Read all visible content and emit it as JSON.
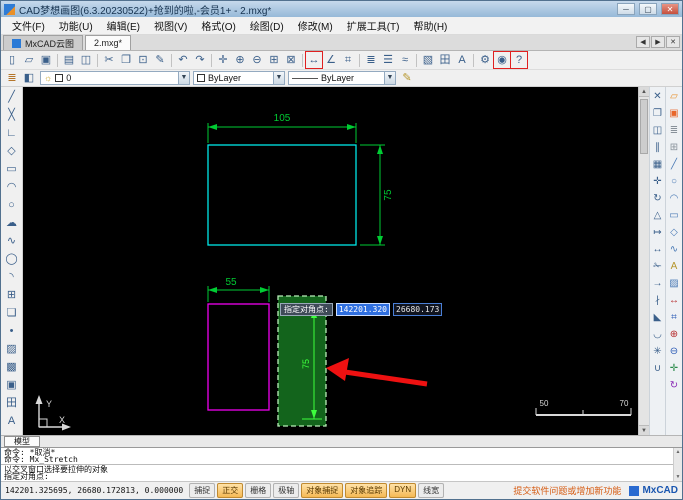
{
  "titlebar": {
    "title": "CAD梦想画图(6.3.20230522)+抢到的啦,-会员1+ - 2.mxg*"
  },
  "menubar": {
    "items": [
      {
        "name": "menu-file",
        "label": "文件(F)"
      },
      {
        "name": "menu-function",
        "label": "功能(U)"
      },
      {
        "name": "menu-edit",
        "label": "编辑(E)"
      },
      {
        "name": "menu-view",
        "label": "视图(V)"
      },
      {
        "name": "menu-format",
        "label": "格式(O)"
      },
      {
        "name": "menu-draw",
        "label": "绘图(D)"
      },
      {
        "name": "menu-modify",
        "label": "修改(M)"
      },
      {
        "name": "menu-ext-tools",
        "label": "扩展工具(T)"
      },
      {
        "name": "menu-help",
        "label": "帮助(H)"
      }
    ]
  },
  "tabbar": {
    "tabs": [
      {
        "label": "MxCAD云图"
      },
      {
        "label": "2.mxg*"
      }
    ]
  },
  "toolbar1": {
    "items": [
      {
        "name": "new-file",
        "glyph": "▯"
      },
      {
        "name": "open-file",
        "glyph": "▱"
      },
      {
        "name": "save-file",
        "glyph": "▣"
      },
      {
        "sep": true
      },
      {
        "name": "plot",
        "glyph": "▤"
      },
      {
        "name": "print-preview",
        "glyph": "◫"
      },
      {
        "sep": true
      },
      {
        "name": "cut",
        "glyph": "✂"
      },
      {
        "name": "copy",
        "glyph": "❐"
      },
      {
        "name": "paste",
        "glyph": "⊡"
      },
      {
        "name": "format-painter",
        "glyph": "✎"
      },
      {
        "sep": true
      },
      {
        "name": "undo",
        "glyph": "↶"
      },
      {
        "name": "redo",
        "glyph": "↷"
      },
      {
        "sep": true
      },
      {
        "name": "pan",
        "glyph": "✛"
      },
      {
        "name": "zoom-in",
        "glyph": "⊕"
      },
      {
        "name": "zoom-out",
        "glyph": "⊖"
      },
      {
        "name": "zoom-window",
        "glyph": "⊞"
      },
      {
        "name": "zoom-extents",
        "glyph": "⊠"
      },
      {
        "sep": true
      },
      {
        "name": "measure-distance",
        "glyph": "↔",
        "hl": true
      },
      {
        "name": "measure-angle",
        "glyph": "∠"
      },
      {
        "name": "measure-area",
        "glyph": "⌗"
      },
      {
        "sep": true
      },
      {
        "name": "layer-manager",
        "glyph": "≣"
      },
      {
        "name": "properties-palette",
        "glyph": "☰"
      },
      {
        "name": "linetype-manager",
        "glyph": "≈"
      },
      {
        "sep": true
      },
      {
        "name": "insert-image",
        "glyph": "▧"
      },
      {
        "name": "insert-table",
        "glyph": "田"
      },
      {
        "name": "find-text",
        "glyph": "A"
      },
      {
        "sep": true
      },
      {
        "name": "options",
        "glyph": "⚙"
      },
      {
        "name": "record-tool",
        "glyph": "◉",
        "hl": true
      },
      {
        "name": "help-tool",
        "glyph": "?",
        "hl": true
      }
    ]
  },
  "toolbar2": {
    "left_icons": [
      {
        "name": "layer-properties",
        "glyph": "≣",
        "color": "#b5762a"
      },
      {
        "name": "layer-states",
        "glyph": "◧",
        "color": "#3a5f8a"
      }
    ],
    "right_icons": [
      {
        "name": "match-properties",
        "glyph": "✎",
        "color": "#b5952a"
      }
    ],
    "layer_value": "0",
    "color_value": "ByLayer",
    "linetype_value": "ByLayer"
  },
  "left_toolbar": {
    "items": [
      {
        "name": "draw-line",
        "glyph": "╱"
      },
      {
        "name": "draw-construction-line",
        "glyph": "╳"
      },
      {
        "name": "draw-polyline",
        "glyph": "∟"
      },
      {
        "name": "draw-polygon",
        "glyph": "◇"
      },
      {
        "name": "draw-rectangle",
        "glyph": "▭"
      },
      {
        "name": "draw-arc",
        "glyph": "◠"
      },
      {
        "name": "draw-circle",
        "glyph": "○"
      },
      {
        "name": "draw-revcloud",
        "glyph": "☁"
      },
      {
        "name": "draw-spline",
        "glyph": "∿"
      },
      {
        "name": "draw-ellipse",
        "glyph": "◯"
      },
      {
        "name": "draw-ellipse-arc",
        "glyph": "◝"
      },
      {
        "name": "insert-block",
        "glyph": "⊞"
      },
      {
        "name": "make-block",
        "glyph": "❏"
      },
      {
        "name": "draw-point",
        "glyph": "•"
      },
      {
        "name": "hatch",
        "glyph": "▨"
      },
      {
        "name": "gradient",
        "glyph": "▩"
      },
      {
        "name": "region",
        "glyph": "▣"
      },
      {
        "name": "table",
        "glyph": "田"
      },
      {
        "name": "mtext",
        "glyph": "A"
      }
    ]
  },
  "right_modify": {
    "items": [
      {
        "name": "erase",
        "glyph": "✕"
      },
      {
        "name": "copy-object",
        "glyph": "❐"
      },
      {
        "name": "mirror",
        "glyph": "◫"
      },
      {
        "name": "offset",
        "glyph": "∥"
      },
      {
        "name": "array",
        "glyph": "▦"
      },
      {
        "name": "move",
        "glyph": "✛"
      },
      {
        "name": "rotate",
        "glyph": "↻"
      },
      {
        "name": "scale",
        "glyph": "△"
      },
      {
        "name": "stretch",
        "glyph": "↦"
      },
      {
        "name": "lengthen",
        "glyph": "↔"
      },
      {
        "name": "trim",
        "glyph": "✁"
      },
      {
        "name": "extend",
        "glyph": "→"
      },
      {
        "name": "break",
        "glyph": "∤"
      },
      {
        "name": "chamfer",
        "glyph": "◣"
      },
      {
        "name": "fillet",
        "glyph": "◡"
      },
      {
        "name": "explode",
        "glyph": "✳"
      },
      {
        "name": "join",
        "glyph": "∪"
      }
    ]
  },
  "right_tools": {
    "items": [
      {
        "name": "open-drawing",
        "glyph": "▱",
        "color": "#e8902a"
      },
      {
        "name": "save-drawing",
        "glyph": "▣",
        "color": "#e8662a"
      },
      {
        "name": "layer-tool",
        "glyph": "≣",
        "color": "#88919a"
      },
      {
        "name": "insert-tool",
        "glyph": "⊞",
        "color": "#88919a"
      },
      {
        "name": "line-tool",
        "glyph": "╱",
        "color": "#4a7ab5"
      },
      {
        "name": "circle-tool",
        "glyph": "○",
        "color": "#4a7ab5"
      },
      {
        "name": "arc-tool",
        "glyph": "◠",
        "color": "#4a7ab5"
      },
      {
        "name": "rect-tool",
        "glyph": "▭",
        "color": "#4a7ab5"
      },
      {
        "name": "polygon-tool",
        "glyph": "◇",
        "color": "#4a7ab5"
      },
      {
        "name": "spline-tool",
        "glyph": "∿",
        "color": "#4a7ab5"
      },
      {
        "name": "text-tool",
        "glyph": "A",
        "color": "#b5952a"
      },
      {
        "name": "hatch-tool",
        "glyph": "▨",
        "color": "#4a7ab5"
      },
      {
        "name": "dimension-tool",
        "glyph": "↔",
        "color": "#b52a2a"
      },
      {
        "name": "measure-tool",
        "glyph": "⌗",
        "color": "#2a5ab5"
      },
      {
        "name": "zoom-in-tool",
        "glyph": "⊕",
        "color": "#b52a2a"
      },
      {
        "name": "zoom-out-tool",
        "glyph": "⊖",
        "color": "#2a5ab5"
      },
      {
        "name": "pan-tool",
        "glyph": "✛",
        "color": "#2a8a4a"
      },
      {
        "name": "regen-tool",
        "glyph": "↻",
        "color": "#8a2ab5"
      }
    ]
  },
  "canvas": {
    "dimensions": {
      "top_width": "105",
      "right_height": "75",
      "bottom_width": "55",
      "inner_height": "75"
    },
    "dyn": {
      "label": "指定对角点:",
      "x_value": "142201.320",
      "y_value": "26680.173"
    },
    "scale_bar": {
      "left_label": "50",
      "right_label": "70"
    },
    "ucs": {
      "x_label": "X",
      "y_label": "Y"
    }
  },
  "model_tab": {
    "label": "模型"
  },
  "command": {
    "history": [
      "命令: *取消*",
      "命令: Mx_Stretch"
    ],
    "prompt": [
      "以交叉窗口选择要拉伸的对象",
      "指定对角点:"
    ]
  },
  "statusbar": {
    "coordinates": "142201.325695, 26680.172813, 0.000000",
    "toggles": [
      {
        "name": "snap",
        "label": "捕捉",
        "active": false
      },
      {
        "name": "ortho",
        "label": "正交",
        "active": true
      },
      {
        "name": "grid",
        "label": "栅格",
        "active": false
      },
      {
        "name": "polar",
        "label": "极轴",
        "active": false
      },
      {
        "name": "osnap",
        "label": "对象捕捉",
        "active": true
      },
      {
        "name": "otrack",
        "label": "对象追踪",
        "active": true
      },
      {
        "name": "dyn",
        "label": "DYN",
        "active": true
      },
      {
        "name": "lineweight",
        "label": "线宽",
        "active": false
      }
    ],
    "link": "提交软件问题或增加新功能",
    "brand": "MxCAD"
  },
  "colors": {
    "entity_cyan": "#00e8e8",
    "entity_magenta": "#f000f0",
    "dimension_green": "#00cc33",
    "selection_fill": "#1ea22d",
    "arrow_red": "#ee1111"
  }
}
